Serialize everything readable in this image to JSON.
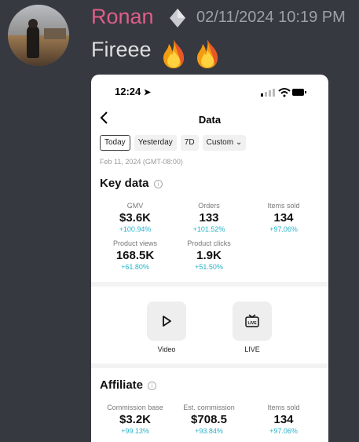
{
  "chat": {
    "username": "Ronan",
    "timestamp": "02/11/2024 10:19 PM",
    "message": "Fireee",
    "emoji_icons": [
      "fire-icon",
      "fire-icon"
    ],
    "colors": {
      "username": "#e05d8a",
      "background": "#36393f"
    }
  },
  "screenshot": {
    "status_time": "12:24",
    "nav_title": "Data",
    "filters": [
      {
        "label": "Today",
        "active": true
      },
      {
        "label": "Yesterday",
        "active": false
      },
      {
        "label": "7D",
        "active": false
      },
      {
        "label": "Custom",
        "active": false
      }
    ],
    "date_sub": "Feb 11, 2024 (GMT-08:00)",
    "key_data": {
      "title": "Key data",
      "metrics": [
        {
          "label": "GMV",
          "value": "$3.6K",
          "change": "+100.94%"
        },
        {
          "label": "Orders",
          "value": "133",
          "change": "+101.52%"
        },
        {
          "label": "Items sold",
          "value": "134",
          "change": "+97.06%"
        },
        {
          "label": "Product views",
          "value": "168.5K",
          "change": "+61.80%"
        },
        {
          "label": "Product clicks",
          "value": "1.9K",
          "change": "+51.50%"
        }
      ]
    },
    "tiles": [
      {
        "label": "Video",
        "icon": "play-icon"
      },
      {
        "label": "LIVE",
        "icon": "live-tv-icon"
      }
    ],
    "affiliate": {
      "title": "Affiliate",
      "metrics": [
        {
          "label": "Commission base",
          "value": "$3.2K",
          "change": "+99.13%"
        },
        {
          "label": "Est. commission",
          "value": "$708.5",
          "change": "+93.84%"
        },
        {
          "label": "Items sold",
          "value": "134",
          "change": "+97.06%"
        }
      ]
    },
    "colors": {
      "change": "#27b3c8"
    }
  }
}
